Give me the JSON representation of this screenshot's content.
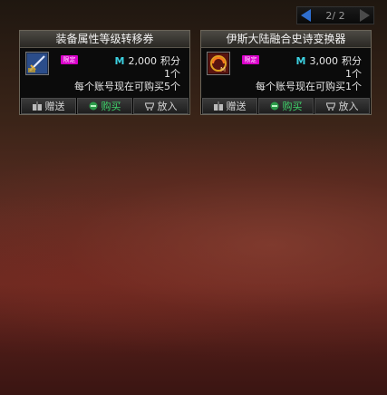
{
  "pager": {
    "label": "2/ 2"
  },
  "cards": [
    {
      "title": "装备属性等级转移券",
      "badge": "限定",
      "currency_icon": "M",
      "price": "2,000",
      "price_unit": "积分",
      "quantity": "1个",
      "limit": "每个账号现在可购买5个",
      "buttons": {
        "gift": "赠送",
        "buy": "购买",
        "cart": "放入"
      }
    },
    {
      "title": "伊斯大陆融合史诗变换器",
      "badge": "限定",
      "currency_icon": "M",
      "price": "3,000",
      "price_unit": "积分",
      "quantity": "1个",
      "limit": "每个账号现在可购买1个",
      "buttons": {
        "gift": "赠送",
        "buy": "购买",
        "cart": "放入"
      }
    }
  ],
  "colors": {
    "accent": "#2f6fd0",
    "buy": "#3fd56b",
    "badge": "#d800c8",
    "currency": "#3cd0e0"
  }
}
